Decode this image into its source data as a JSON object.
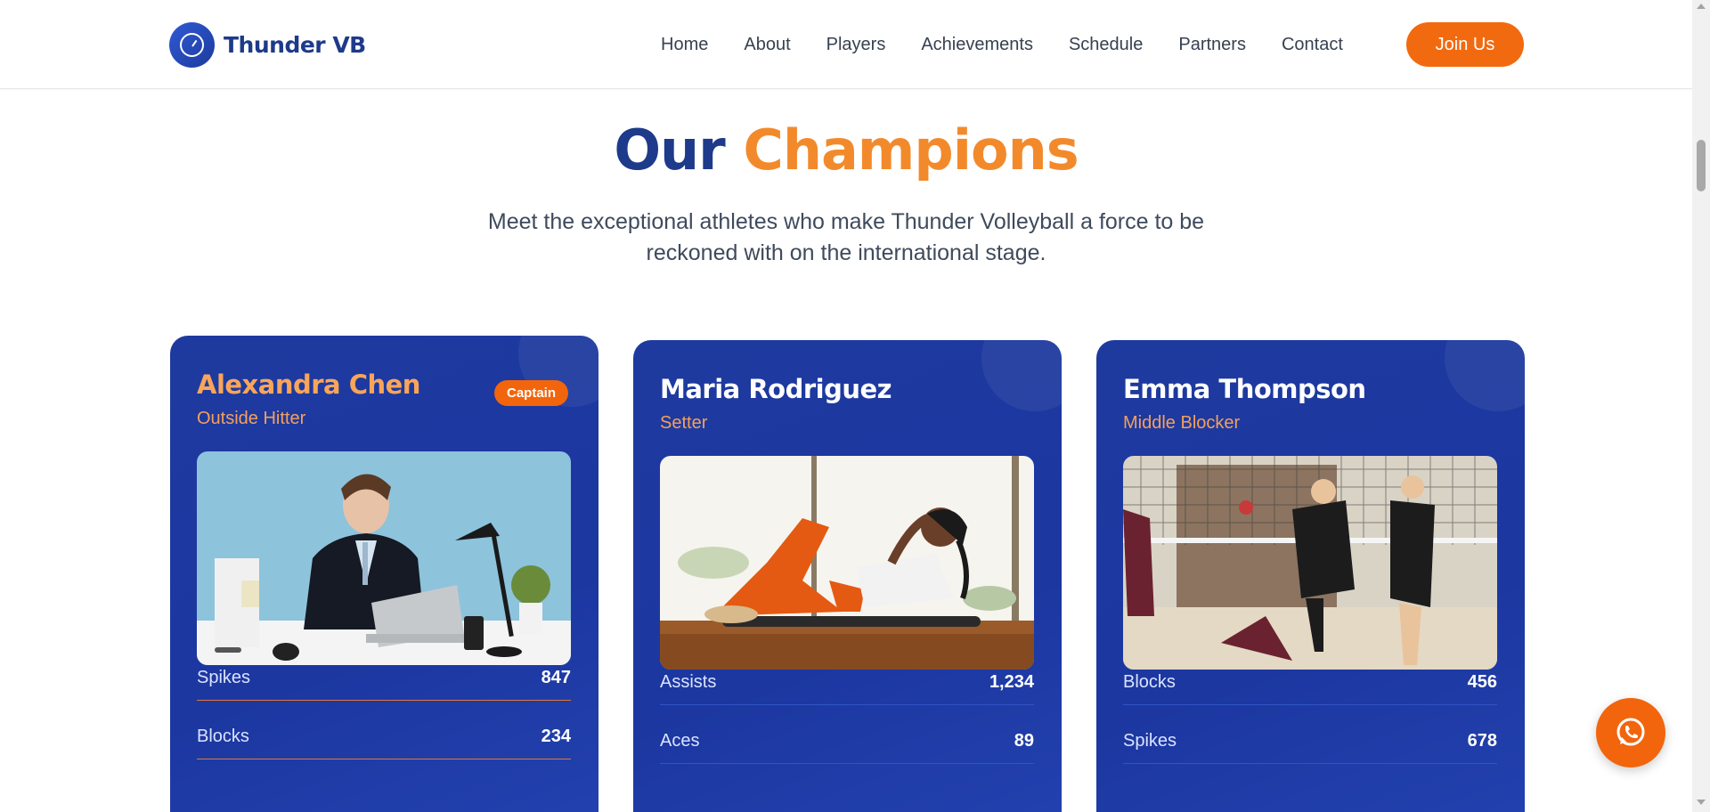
{
  "header": {
    "logo_text": "Thunder VB",
    "nav": [
      "Home",
      "About",
      "Players",
      "Achievements",
      "Schedule",
      "Partners",
      "Contact"
    ],
    "cta": "Join Us"
  },
  "section": {
    "title_part1": "Our",
    "title_part2": "Champions",
    "subtitle_line1": "Meet the exceptional athletes who make Thunder Volleyball a force to be",
    "subtitle_line2": "reckoned with on the international stage."
  },
  "players": [
    {
      "name": "Alexandra Chen",
      "role": "Outside Hitter",
      "badge": "Captain",
      "photo": "businessman-at-desk-photo",
      "stats": [
        {
          "label": "Spikes",
          "value": "847"
        },
        {
          "label": "Blocks",
          "value": "234"
        }
      ]
    },
    {
      "name": "Maria Rodriguez",
      "role": "Setter",
      "photo": "athlete-doing-situps-photo",
      "stats": [
        {
          "label": "Assists",
          "value": "1,234"
        },
        {
          "label": "Aces",
          "value": "89"
        }
      ]
    },
    {
      "name": "Emma Thompson",
      "role": "Middle Blocker",
      "photo": "volleyball-match-photo",
      "stats": [
        {
          "label": "Blocks",
          "value": "456"
        },
        {
          "label": "Spikes",
          "value": "678"
        }
      ]
    }
  ],
  "colors": {
    "navy": "#1e3a8a",
    "orange": "#f28a2c",
    "card_blue": "#1c37a0",
    "cta_orange": "#f26a0f"
  },
  "floating": {
    "icon": "whatsapp-icon"
  }
}
